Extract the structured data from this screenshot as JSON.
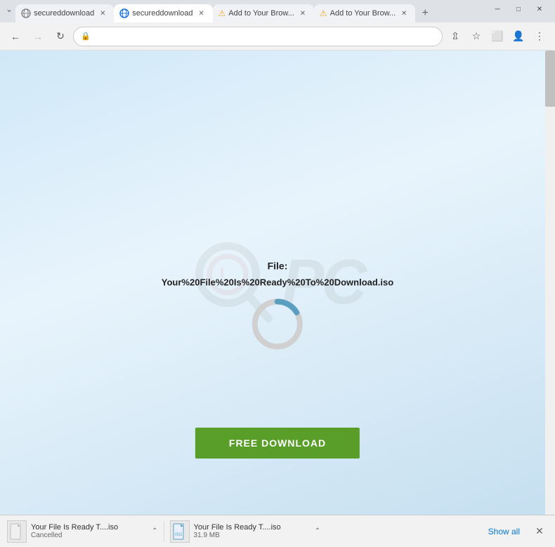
{
  "browser": {
    "tabs": [
      {
        "id": "tab1",
        "title": "secureddownload",
        "favicon": "globe",
        "active": false,
        "warning": false
      },
      {
        "id": "tab2",
        "title": "secureddownload",
        "favicon": "globe",
        "active": true,
        "warning": false
      },
      {
        "id": "tab3",
        "title": "Add to Your Brow...",
        "favicon": "warning",
        "active": false,
        "warning": true
      },
      {
        "id": "tab4",
        "title": "Add to Your Brow...",
        "favicon": "warning",
        "active": false,
        "warning": true
      }
    ],
    "new_tab_label": "+",
    "window_controls": {
      "minimize": "─",
      "maximize": "□",
      "close": "✕"
    },
    "toolbar": {
      "back_disabled": false,
      "forward_disabled": true,
      "address": "",
      "lock_icon": "🔒"
    }
  },
  "page": {
    "background_gradient_start": "#d0e8f8",
    "background_gradient_end": "#c5dff0",
    "watermark_text": "PC",
    "file_label": "File:",
    "file_name": "Your%20File%20Is%20Ready%20To%20Download.iso",
    "download_button_label": "FREE DOWNLOAD",
    "circular_progress": {
      "size": 80,
      "stroke_width": 8,
      "filled_color": "#5a9fbf",
      "empty_color": "#d0d0d0",
      "progress_degrees": 60
    }
  },
  "download_bar": {
    "items": [
      {
        "id": "dl1",
        "filename": "Your File Is Ready T....iso",
        "status": "Cancelled",
        "has_chevron": true
      },
      {
        "id": "dl2",
        "filename": "Your File Is Ready T....iso",
        "status": "31.9 MB",
        "has_chevron": true
      }
    ],
    "show_all_label": "Show all",
    "close_icon": "✕"
  }
}
